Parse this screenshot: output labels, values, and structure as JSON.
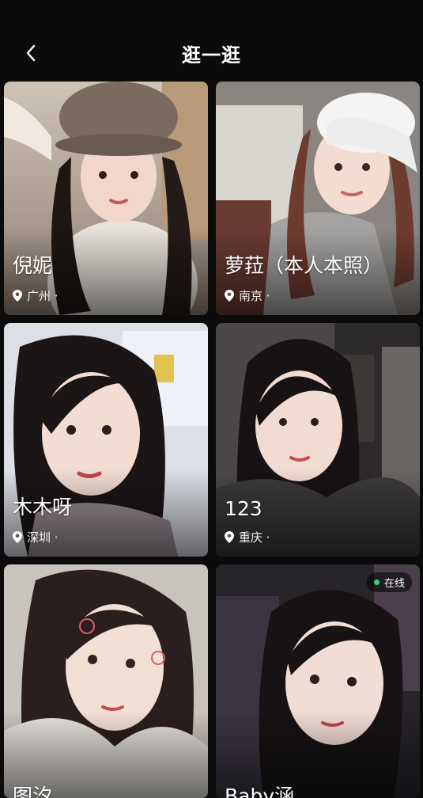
{
  "header": {
    "title": "逛一逛",
    "back_icon": "chevron-left-icon"
  },
  "accent": {
    "online": "#34d16a"
  },
  "cards": [
    {
      "name": "倪妮",
      "city": "广州 ·"
    },
    {
      "name": "萝菈（本人本照）",
      "city": "南京 ·"
    },
    {
      "name": "木木呀",
      "city": "深圳 ·"
    },
    {
      "name": "123",
      "city": "重庆 ·"
    },
    {
      "name": "图汐",
      "city": ""
    },
    {
      "name": "Baby涵",
      "city": "",
      "status": "在线"
    }
  ]
}
